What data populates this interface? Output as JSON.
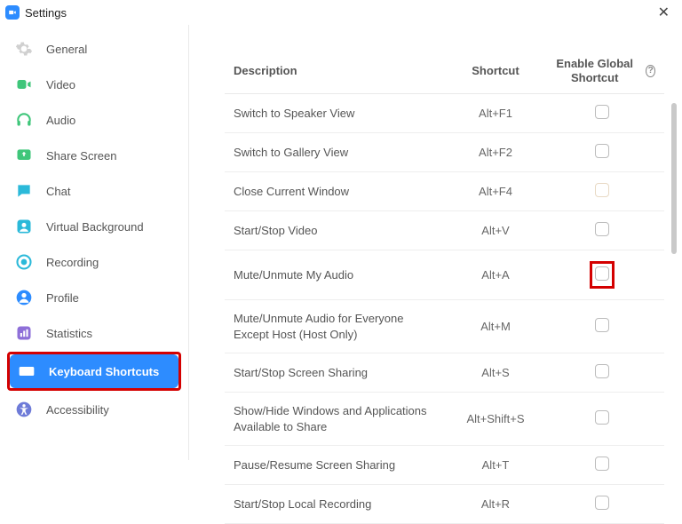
{
  "window": {
    "title": "Settings"
  },
  "sidebar": {
    "items": [
      {
        "label": "General"
      },
      {
        "label": "Video"
      },
      {
        "label": "Audio"
      },
      {
        "label": "Share Screen"
      },
      {
        "label": "Chat"
      },
      {
        "label": "Virtual Background"
      },
      {
        "label": "Recording"
      },
      {
        "label": "Profile"
      },
      {
        "label": "Statistics"
      },
      {
        "label": "Keyboard Shortcuts"
      },
      {
        "label": "Accessibility"
      }
    ]
  },
  "table": {
    "headers": {
      "description": "Description",
      "shortcut": "Shortcut",
      "enable": "Enable Global Shortcut"
    },
    "rows": [
      {
        "desc": "Switch to Speaker View",
        "shortcut": "Alt+F1"
      },
      {
        "desc": "Switch to Gallery View",
        "shortcut": "Alt+F2"
      },
      {
        "desc": "Close Current Window",
        "shortcut": "Alt+F4"
      },
      {
        "desc": "Start/Stop Video",
        "shortcut": "Alt+V"
      },
      {
        "desc": "Mute/Unmute My Audio",
        "shortcut": "Alt+A"
      },
      {
        "desc": "Mute/Unmute Audio for Everyone Except Host (Host Only)",
        "shortcut": "Alt+M"
      },
      {
        "desc": "Start/Stop Screen Sharing",
        "shortcut": "Alt+S"
      },
      {
        "desc": "Show/Hide Windows and Applications Available to Share",
        "shortcut": "Alt+Shift+S"
      },
      {
        "desc": "Pause/Resume Screen Sharing",
        "shortcut": "Alt+T"
      },
      {
        "desc": "Start/Stop Local Recording",
        "shortcut": "Alt+R"
      }
    ]
  }
}
